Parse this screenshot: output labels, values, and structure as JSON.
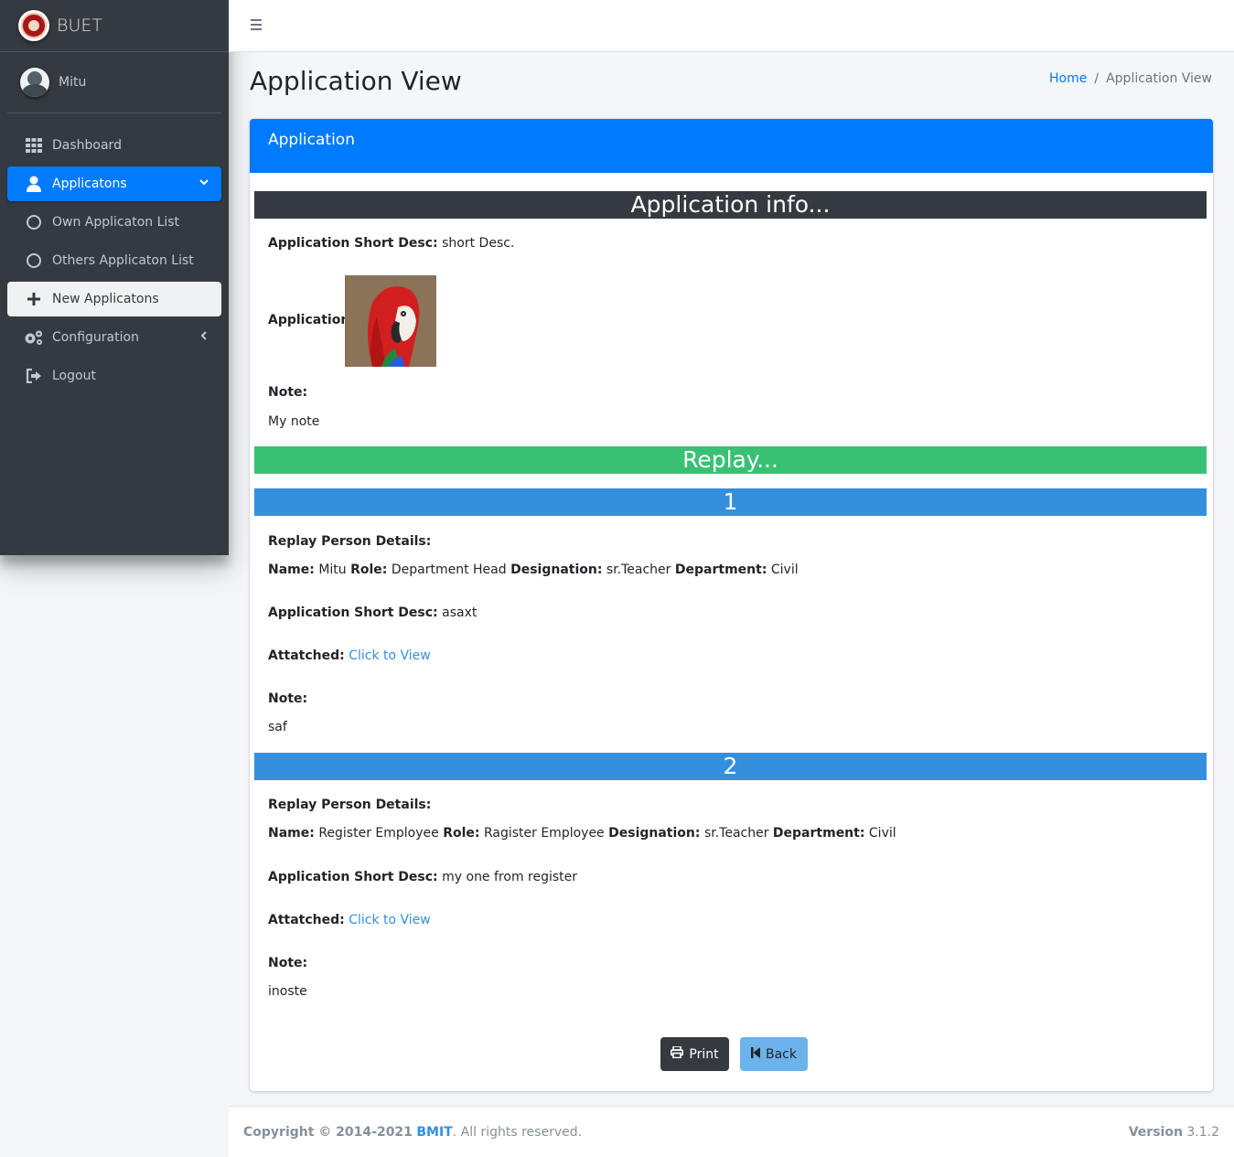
{
  "brand": {
    "name": "BUET"
  },
  "user": {
    "name": "Mitu"
  },
  "sidebar": {
    "items": [
      {
        "label": "Dashboard",
        "icon": "grid-icon"
      },
      {
        "label": "Applicatons",
        "icon": "user-icon",
        "active": true
      },
      {
        "label": "Own Applicaton List",
        "icon": "circle-icon"
      },
      {
        "label": "Others Applicaton List",
        "icon": "circle-icon"
      },
      {
        "label": "New Applicatons",
        "icon": "plus-icon"
      },
      {
        "label": "Configuration",
        "icon": "cogs-icon"
      },
      {
        "label": "Logout",
        "icon": "sign-out-icon"
      }
    ]
  },
  "header": {
    "title": "Application View",
    "breadcrumb_home": "Home",
    "breadcrumb_sep": "/",
    "breadcrumb_current": "Application View"
  },
  "card": {
    "title": "Application",
    "info_band": "Application info...",
    "short_desc_label": "Application Short Desc:",
    "short_desc": "short Desc.",
    "application_label": "Application:",
    "note_label": "Note:",
    "note": "My note",
    "replay_band": "Replay..."
  },
  "replies": [
    {
      "number": "1",
      "details_label": "Replay Person Details:",
      "name_label": "Name:",
      "name": "Mitu",
      "role_label": "Role:",
      "role": "Department Head",
      "designation_label": "Designation:",
      "designation": "sr.Teacher",
      "department_label": "Department:",
      "department": "Civil",
      "short_desc_label": "Application Short Desc:",
      "short_desc": "asaxt",
      "attached_label": "Attatched:",
      "attached_link": "Click to View",
      "note_label": "Note:",
      "note": "saf"
    },
    {
      "number": "2",
      "details_label": "Replay Person Details:",
      "name_label": "Name:",
      "name": "Register Employee",
      "role_label": "Role:",
      "role": "Ragister Employee",
      "designation_label": "Designation:",
      "designation": "sr.Teacher",
      "department_label": "Department:",
      "department": "Civil",
      "short_desc_label": "Application Short Desc:",
      "short_desc": "my one from register",
      "attached_label": "Attatched:",
      "attached_link": "Click to View",
      "note_label": "Note:",
      "note": "inoste"
    }
  ],
  "buttons": {
    "print": "Print",
    "back": "Back"
  },
  "footer": {
    "copyright": "Copyright © 2014-2021",
    "company": "BMIT",
    "rights": ". All rights reserved.",
    "version_label": "Version",
    "version": "3.1.2"
  },
  "colors": {
    "primary": "#007bff",
    "dark": "#343a40",
    "green": "#38c172",
    "blue": "#3490dc"
  }
}
